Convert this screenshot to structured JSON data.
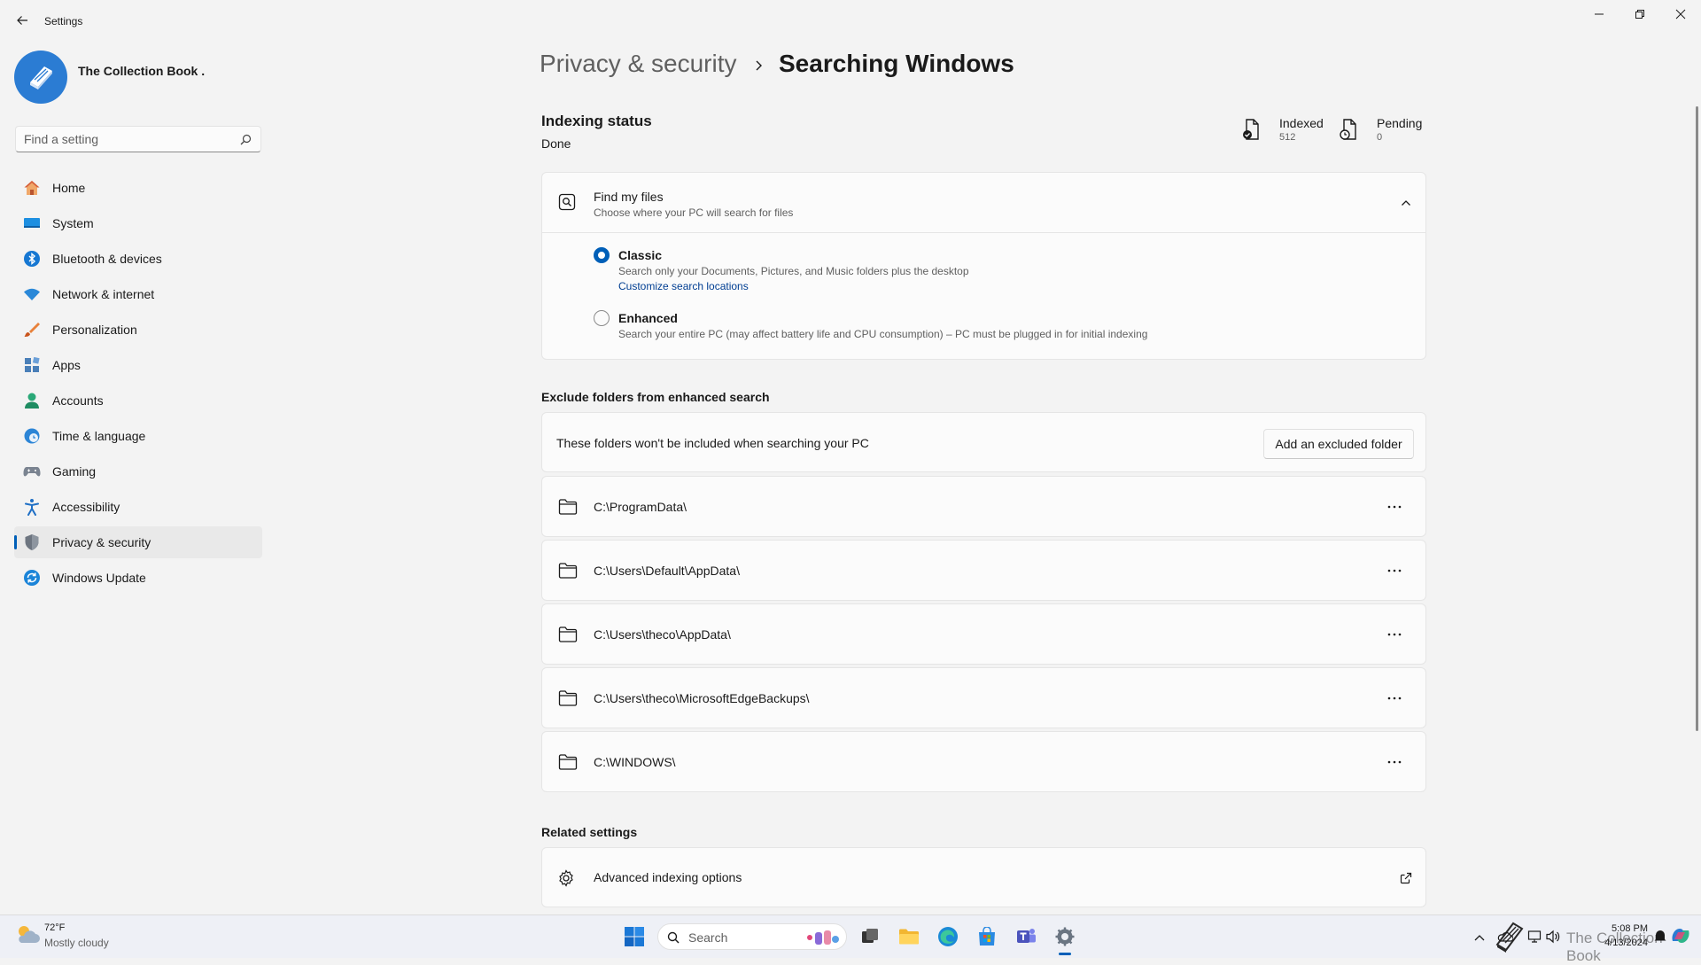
{
  "window": {
    "title": "Settings",
    "controls": [
      "minimize",
      "restore",
      "close"
    ]
  },
  "profile": {
    "name": "The Collection Book ."
  },
  "search": {
    "placeholder": "Find a setting"
  },
  "nav": {
    "items": [
      {
        "label": "Home",
        "icon": "home-icon"
      },
      {
        "label": "System",
        "icon": "system-icon"
      },
      {
        "label": "Bluetooth & devices",
        "icon": "bluetooth-icon"
      },
      {
        "label": "Network & internet",
        "icon": "wifi-icon"
      },
      {
        "label": "Personalization",
        "icon": "brush-icon"
      },
      {
        "label": "Apps",
        "icon": "apps-icon"
      },
      {
        "label": "Accounts",
        "icon": "accounts-icon"
      },
      {
        "label": "Time & language",
        "icon": "clock-globe-icon"
      },
      {
        "label": "Gaming",
        "icon": "gamepad-icon"
      },
      {
        "label": "Accessibility",
        "icon": "accessibility-icon"
      },
      {
        "label": "Privacy & security",
        "icon": "shield-icon",
        "active": true
      },
      {
        "label": "Windows Update",
        "icon": "update-icon"
      }
    ]
  },
  "breadcrumb": {
    "parent": "Privacy & security",
    "current": "Searching Windows"
  },
  "indexing": {
    "title": "Indexing status",
    "status": "Done",
    "indexed_label": "Indexed",
    "indexed_value": "512",
    "pending_label": "Pending",
    "pending_value": "0"
  },
  "find_my_files": {
    "title": "Find my files",
    "description": "Choose where your PC will search for files",
    "expanded": true,
    "options": [
      {
        "title": "Classic",
        "description": "Search only your Documents, Pictures, and Music folders plus the desktop",
        "link": "Customize search locations",
        "selected": true
      },
      {
        "title": "Enhanced",
        "description": "Search your entire PC (may affect battery life and CPU consumption) – PC must be plugged in for initial indexing",
        "selected": false
      }
    ]
  },
  "exclude": {
    "section_title": "Exclude folders from enhanced search",
    "description": "These folders won't be included when searching your PC",
    "add_button": "Add an excluded folder",
    "folders": [
      "C:\\ProgramData\\",
      "C:\\Users\\Default\\AppData\\",
      "C:\\Users\\theco\\AppData\\",
      "C:\\Users\\theco\\MicrosoftEdgeBackups\\",
      "C:\\WINDOWS\\"
    ]
  },
  "related": {
    "section_title": "Related settings",
    "items": [
      {
        "label": "Advanced indexing options",
        "icon": "gear-icon",
        "trailing_icon": "external-link-icon"
      }
    ]
  },
  "taskbar": {
    "weather_temp": "72°F",
    "weather_desc": "Mostly cloudy",
    "search_label": "Search",
    "time": "5:08 PM",
    "date": "4/13/2024",
    "watermark": "The Collection Book",
    "accent": "#005fb8"
  }
}
